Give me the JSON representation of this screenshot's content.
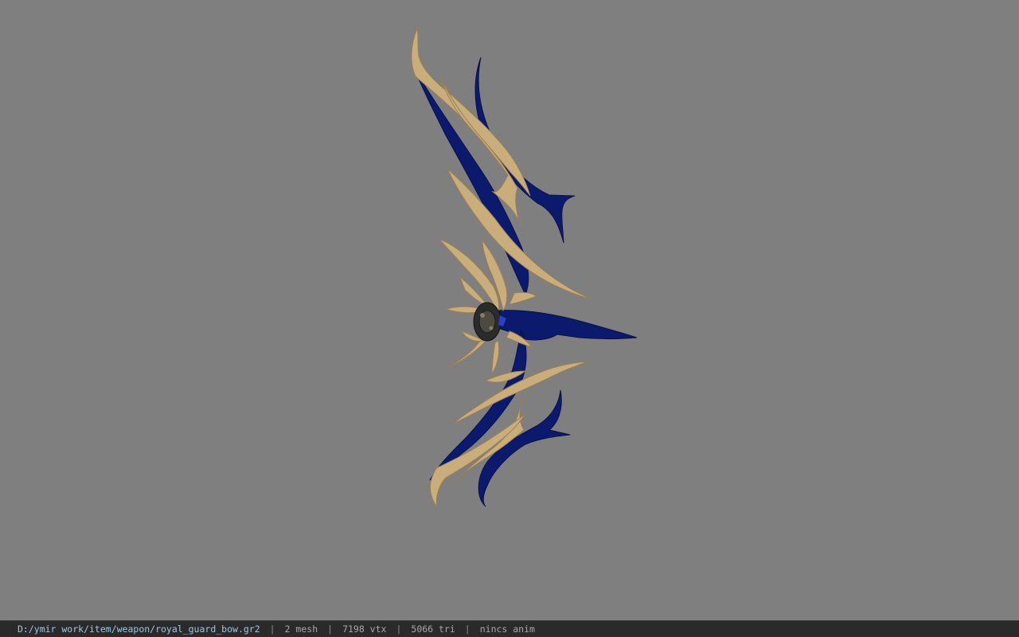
{
  "viewer": {
    "background_color": "#7f7f7f",
    "model": {
      "colors": {
        "gold": "#c9ae7c",
        "gold_shadow": "#9a7f52",
        "blue": "#0c1a6e",
        "blue_dark": "#071148",
        "core": "#2b2b2b"
      }
    }
  },
  "statusbar": {
    "file_path": "D:/ymir work/item/weapon/royal_guard_bow.gr2",
    "separator": "|",
    "mesh_count": "2 mesh",
    "vertex_count": "7198 vtx",
    "triangle_count": "5066 tri",
    "anim_status": "nincs anim"
  }
}
